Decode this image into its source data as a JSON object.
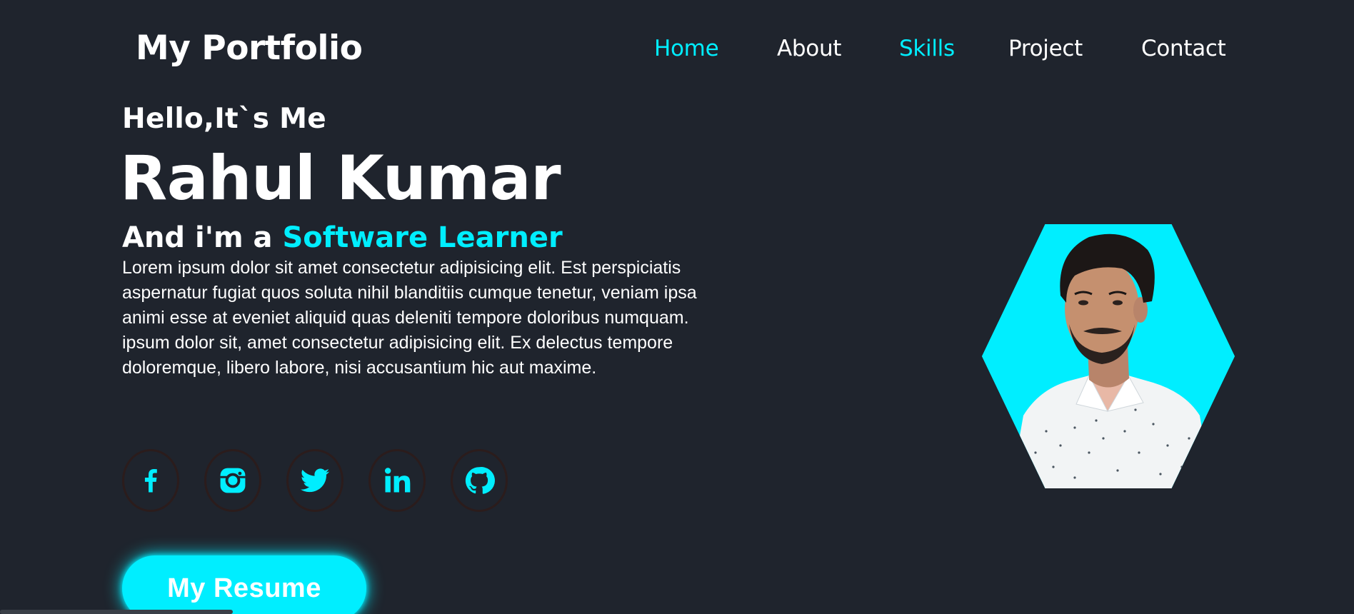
{
  "header": {
    "logo": "My Portfolio",
    "nav": [
      {
        "label": "Home",
        "active": true
      },
      {
        "label": "About",
        "active": false
      },
      {
        "label": "Skills",
        "active": true
      },
      {
        "label": "Project",
        "active": false
      },
      {
        "label": "Contact",
        "active": false
      }
    ]
  },
  "hero": {
    "greeting": "Hello,It`s Me",
    "name": "Rahul Kumar",
    "role_prefix": "And i'm a ",
    "role_highlight": "Software Learner",
    "description": "Lorem ipsum dolor sit amet consectetur adipisicing elit. Est perspiciatis aspernatur fugiat quos soluta nihil blanditiis cumque tenetur, veniam ipsa animi esse at eveniet aliquid quas deleniti tempore doloribus numquam. ipsum dolor sit, amet consectetur adipisicing elit. Ex delectus tempore doloremque, libero labore, nisi accusantium hic aut maxime.",
    "resume_button": "My Resume"
  },
  "social": [
    {
      "icon": "facebook-icon"
    },
    {
      "icon": "instagram-icon"
    },
    {
      "icon": "twitter-icon"
    },
    {
      "icon": "linkedin-icon"
    },
    {
      "icon": "github-icon"
    }
  ],
  "colors": {
    "background": "#1f242d",
    "accent": "#00eeff",
    "text": "#ffffff"
  }
}
